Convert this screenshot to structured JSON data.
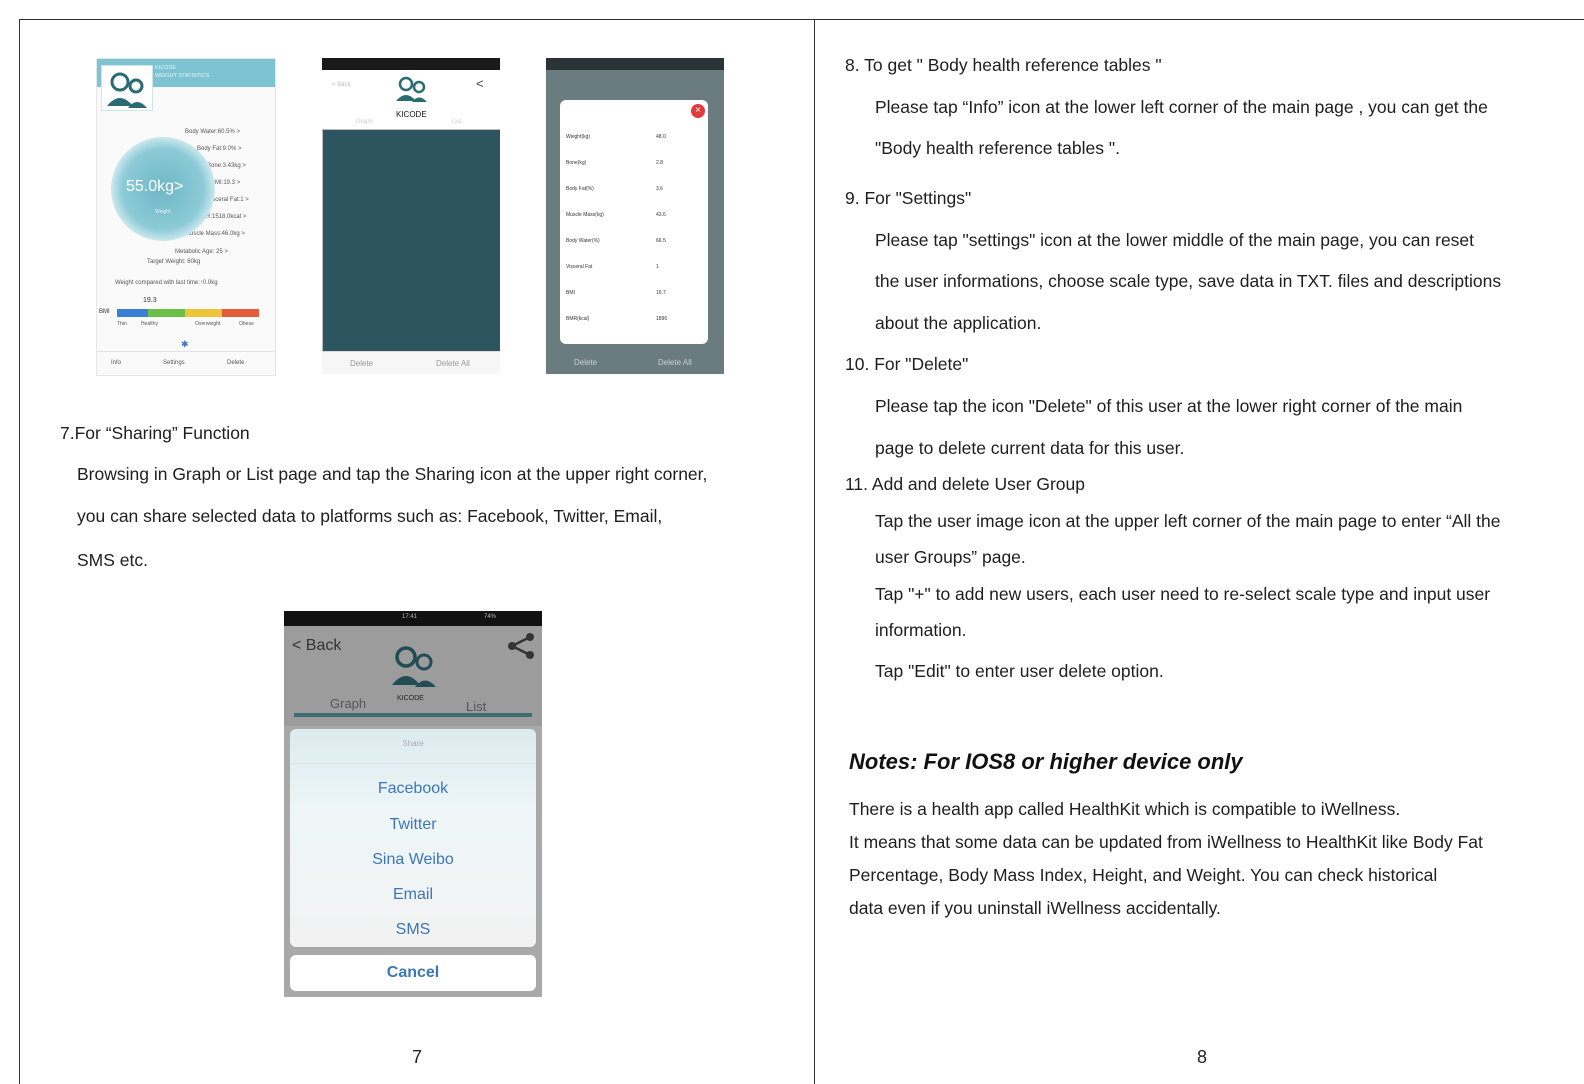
{
  "left_page": {
    "section7_title": "7.For “Sharing” Function",
    "section7_lines": [
      "Browsing in Graph or List page and tap the Sharing icon at the upper right corner,",
      "you can share selected data to platforms such as: Facebook, Twitter, Email,",
      "SMS etc."
    ],
    "page_number": "7"
  },
  "screens": {
    "main": {
      "header_line1": "KICODE",
      "header_line2": "WEIGHT STATISTICS",
      "metrics": [
        "Body Water:60.5% >",
        "Body Fat:9.0% >",
        "Bone:3.43kg >",
        "BMI:19.3 >",
        "Visceral Fat:1 >",
        "BMR:1518.0kcal >",
        "Muscle Mass:46.0kg >",
        "Metabolic Age: 25 >"
      ],
      "weight_value": "55.0kg>",
      "weight_caption": "Weight",
      "target_weight": "Target Weight: 60kg",
      "compare_text": "Weight compared with last time:↑0.0kg",
      "bmi_value": "19.3",
      "bmi_label": "BMI",
      "bmi_categories": [
        "Thin",
        "Healthy",
        "Overweight",
        "Obese"
      ],
      "bottom_items": [
        "Info",
        "Settings",
        "Delete"
      ]
    },
    "graph": {
      "back": "< Back",
      "brand": "KICODE",
      "tabs": [
        "Graph",
        "List"
      ],
      "footer": [
        "Delete",
        "Delete All"
      ]
    },
    "detail": {
      "rows": [
        {
          "label": "Weight(kg)",
          "value": "48.0"
        },
        {
          "label": "Bone(kg)",
          "value": "2.8"
        },
        {
          "label": "Body Fat(%)",
          "value": "3.6"
        },
        {
          "label": "Muscle Mass(kg)",
          "value": "43.6"
        },
        {
          "label": "Body Water(%)",
          "value": "66.5"
        },
        {
          "label": "Visceral Fat",
          "value": "1"
        },
        {
          "label": "BMI",
          "value": "16.7"
        },
        {
          "label": "BMR(kcal)",
          "value": "1896"
        }
      ],
      "footer": [
        "Delete",
        "Delete All"
      ]
    },
    "share": {
      "time": "17:41",
      "battery": "74%",
      "back": "< Back",
      "brand": "KICODE",
      "tab_graph": "Graph",
      "tab_list": "List",
      "sheet_title": "Share",
      "options": [
        "Facebook",
        "Twitter",
        "Sina Weibo",
        "Email",
        "SMS"
      ],
      "cancel": "Cancel"
    }
  },
  "right_page": {
    "items": [
      {
        "line": "8.   To get \" Body health reference tables \""
      },
      {
        "line": "Please tap “Info” icon at the lower left corner of the main page , you can get the"
      },
      {
        "line": "\"Body health reference tables \"."
      },
      {
        "line": "9.   For \"Settings\""
      },
      {
        "line": "Please tap \"settings\" icon at the lower middle of the main page, you can reset"
      },
      {
        "line": "the user informations, choose scale type, save data in TXT. files and descriptions"
      },
      {
        "line": "about the application."
      },
      {
        "line": "10. For \"Delete\""
      },
      {
        "line": "Please tap the icon \"Delete\" of this user at the lower right corner of the main"
      },
      {
        "line": "page to delete current data for this user."
      },
      {
        "line": "11. Add and delete User Group"
      },
      {
        "line": "Tap the user image icon at the upper left corner of the main page to enter “All the"
      },
      {
        "line": "user Groups” page."
      },
      {
        "line": "Tap \"+\" to add new users, each user need to re-select scale type and input user"
      },
      {
        "line": "information."
      },
      {
        "line": "Tap \"Edit\" to enter user delete option."
      }
    ],
    "notes_title": "Notes: For IOS8 or higher device only",
    "notes_lines": [
      "There is a health app called HealthKit which is compatible to iWellness.",
      "It means that some data can be updated from iWellness to HealthKit like Body Fat",
      "Percentage, Body Mass Index, Height,  and Weight. You can check  historical",
      "data even if you uninstall iWellness accidentally."
    ],
    "page_number": "8"
  }
}
